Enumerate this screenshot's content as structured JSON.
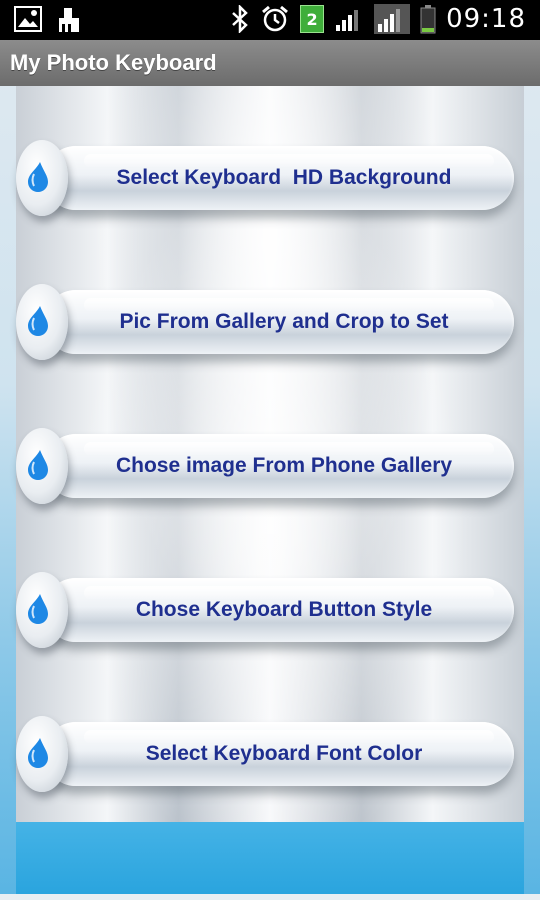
{
  "status_bar": {
    "time": "09:18",
    "sim_badge": "2",
    "left_icons": [
      "gallery-icon",
      "cleaner-icon"
    ],
    "right_icons": [
      "bluetooth-icon",
      "alarm-icon",
      "sim-2-icon",
      "signal-strength-icon",
      "signal-strength-secondary-icon",
      "battery-icon"
    ]
  },
  "app": {
    "title": "My Photo Keyboard"
  },
  "menu": {
    "items": [
      {
        "label": "Select Keyboard  HD Background",
        "icon": "blue-drop-icon"
      },
      {
        "label": "Pic From Gallery and Crop to Set",
        "icon": "blue-drop-icon"
      },
      {
        "label": "Chose image From Phone Gallery",
        "icon": "blue-drop-icon"
      },
      {
        "label": "Chose Keyboard Button Style",
        "icon": "blue-drop-icon"
      },
      {
        "label": "Select Keyboard Font Color",
        "icon": "blue-drop-icon"
      }
    ]
  },
  "colors": {
    "label_text": "#1f2f8f",
    "drop_blue": "#1e88e5",
    "bottom_band": "#2aa4de",
    "title_bar": "#7a7a7a"
  }
}
